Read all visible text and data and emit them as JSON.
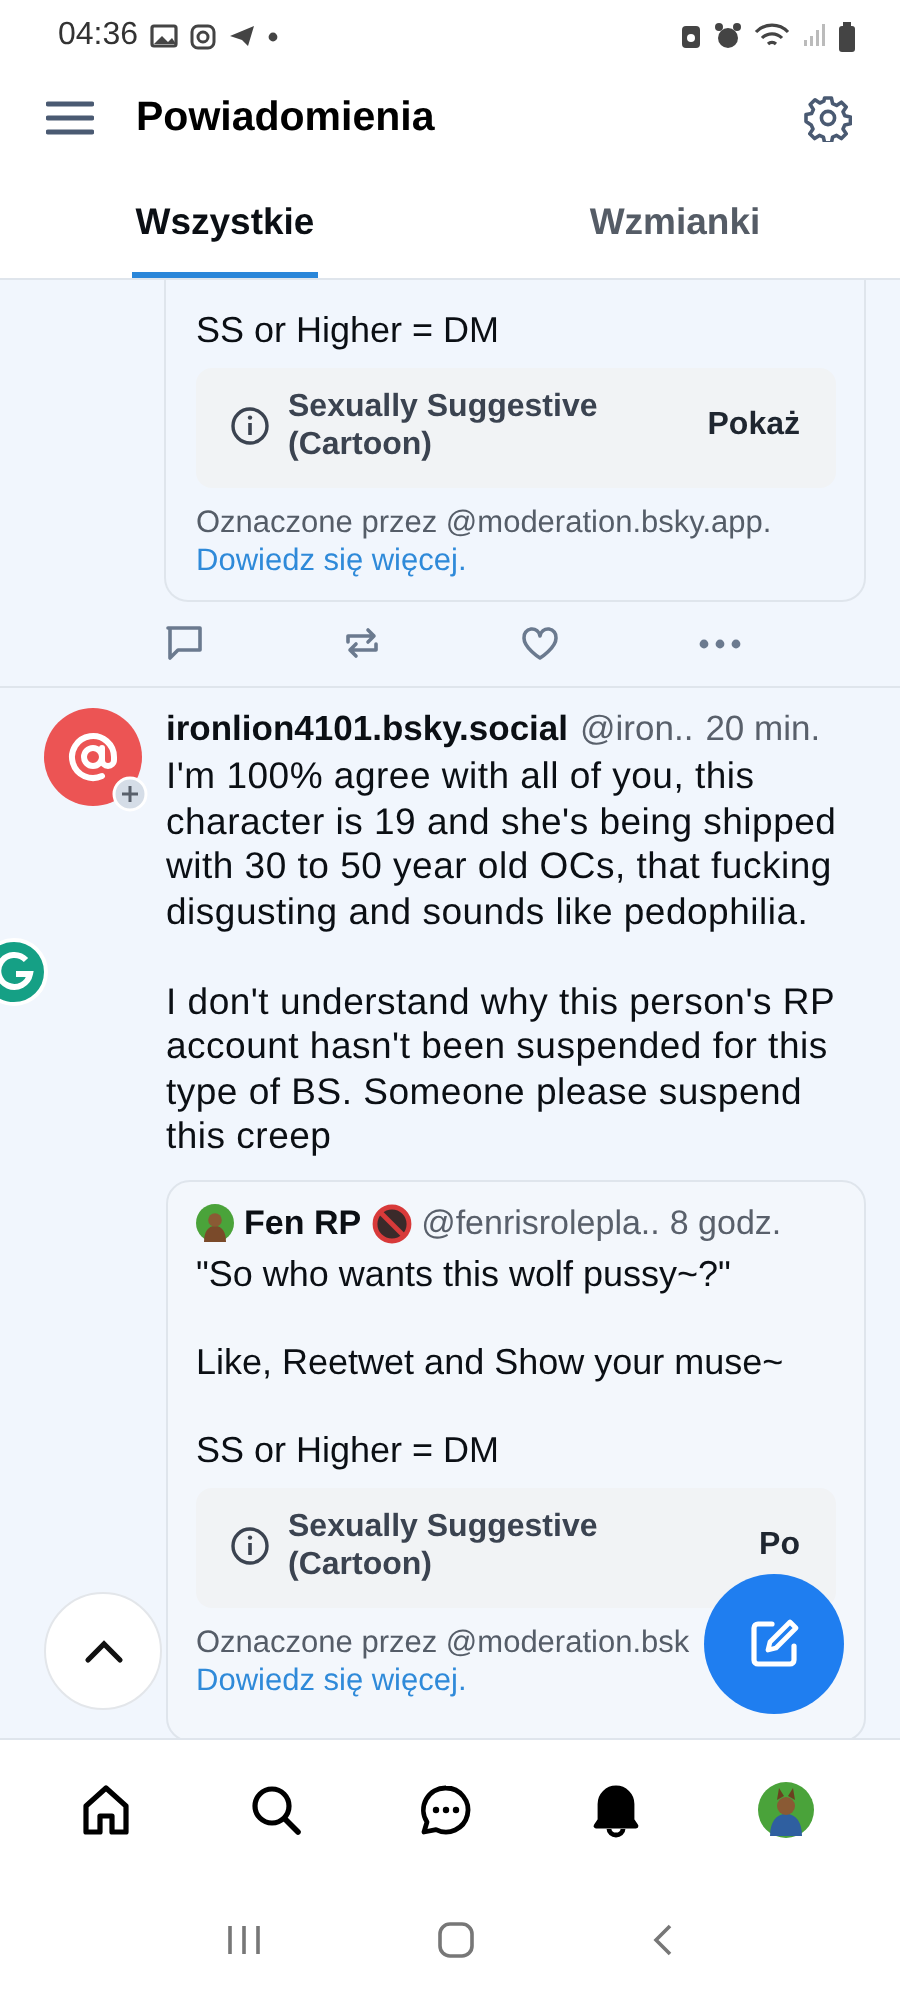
{
  "status_bar": {
    "time": "04:36"
  },
  "header": {
    "title": "Powiadomienia"
  },
  "tabs": [
    {
      "label": "Wszystkie",
      "selected": true
    },
    {
      "label": "Wzmianki",
      "selected": false
    }
  ],
  "top_post": {
    "text": "SS or Higher = DM",
    "label": {
      "title": "Sexually Suggestive (Cartoon)",
      "action": "Pokaż"
    },
    "labeled_by": "Oznaczone przez @moderation.bsky.app.",
    "learn_more": "Dowiedz się więcej."
  },
  "reply": {
    "display_name": "ironlion4101.bsky.social",
    "handle": "@iron..",
    "time": "20 min.",
    "text": "I'm 100% agree with all of you, this character is 19 and she's being shipped with 30 to 50 year old OCs, that fucking disgusting and sounds like pedophilia.\n\nI don't understand why this person's RP account hasn't been suspended for this type of BS. Someone please suspend this creep",
    "quote": {
      "display_name": "Fen RP",
      "handle": "@fenrisrolepla..",
      "time": "8 godz.",
      "text": "\"So who wants this wolf pussy~?\"\n\nLike, Reetwet and Show your muse~\n\nSS or Higher = DM",
      "label": {
        "title": "Sexually Suggestive (Cartoon)",
        "action": "Po"
      },
      "labeled_by": "Oznaczone przez @moderation.bsk",
      "learn_more": "Dowiedz się więcej."
    }
  },
  "nav": [
    {
      "kind": "home",
      "selected": false
    },
    {
      "kind": "search",
      "selected": false
    },
    {
      "kind": "chat",
      "selected": false
    },
    {
      "kind": "notifications",
      "selected": true
    },
    {
      "kind": "profile",
      "selected": false
    }
  ]
}
